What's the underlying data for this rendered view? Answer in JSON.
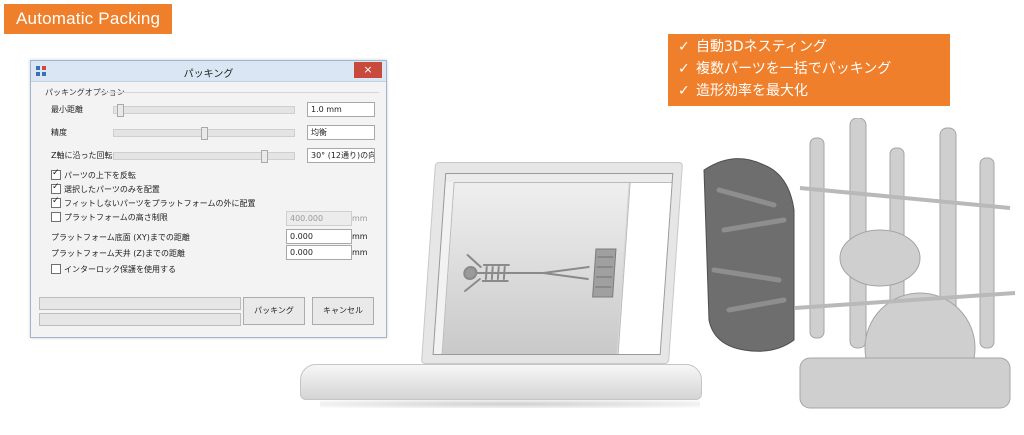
{
  "banner": {
    "title": "Automatic Packing"
  },
  "features": {
    "check_glyph": "✓",
    "items": [
      "自動3Dネスティング",
      "複数パーツを一括でパッキング",
      "造形効率を最大化"
    ]
  },
  "dialog": {
    "title": "パッキング",
    "close_glyph": "×",
    "group_label": "パッキングオプション",
    "sliders": [
      {
        "label": "最小距離",
        "value": "1.0 mm",
        "level": 0.02
      },
      {
        "label": "精度",
        "value": "均衡",
        "level": 0.5
      },
      {
        "label": "Z軸に沿った回転",
        "value": "30° (12通り)の向き",
        "level": 0.85
      }
    ],
    "checkboxes": [
      {
        "label": "パーツの上下を反転",
        "checked": true
      },
      {
        "label": "選択したパーツのみを配置",
        "checked": true
      },
      {
        "label": "フィットしないパーツをプラットフォームの外に配置",
        "checked": true
      }
    ],
    "height_limit": {
      "label": "プラットフォームの高さ制限",
      "checked": false,
      "value": "400.000",
      "unit": "mm"
    },
    "distances": [
      {
        "label": "プラットフォーム底面 (XY)までの距離",
        "value": "0.000",
        "unit": "mm"
      },
      {
        "label": "プラットフォーム天井 (Z)までの距離",
        "value": "0.000",
        "unit": "mm"
      }
    ],
    "interlock": {
      "label": "インターロック保護を使用する",
      "checked": false
    },
    "buttons": {
      "pack": "パッキング",
      "cancel": "キャンセル"
    }
  }
}
